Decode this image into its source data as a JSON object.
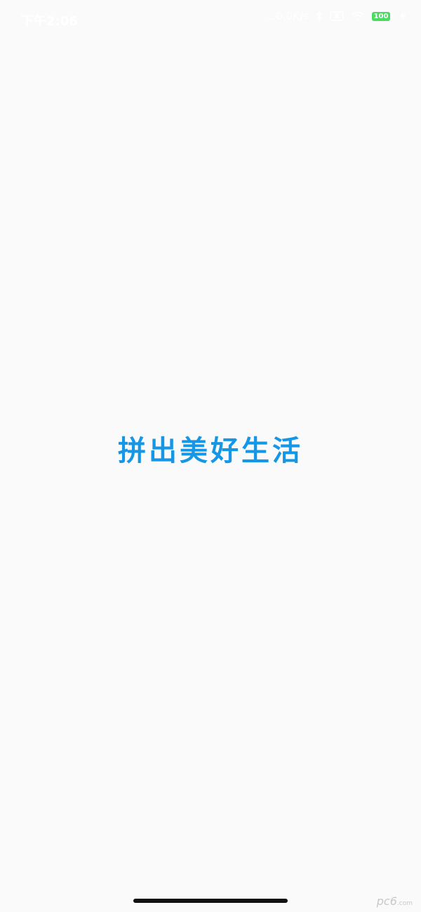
{
  "status_bar": {
    "time": "下午2:06",
    "network_speed": "...0.0K/s",
    "battery_level": "100",
    "icons": [
      "bluetooth-icon",
      "sim-icon",
      "wifi-icon",
      "battery-icon",
      "charging-icon"
    ]
  },
  "main": {
    "slogan": "拼出美好生活"
  },
  "colors": {
    "accent": "#1597e5",
    "background": "#fafafa",
    "battery": "#4cd964"
  },
  "watermark": {
    "brand": "pc6",
    "suffix": ".com"
  }
}
